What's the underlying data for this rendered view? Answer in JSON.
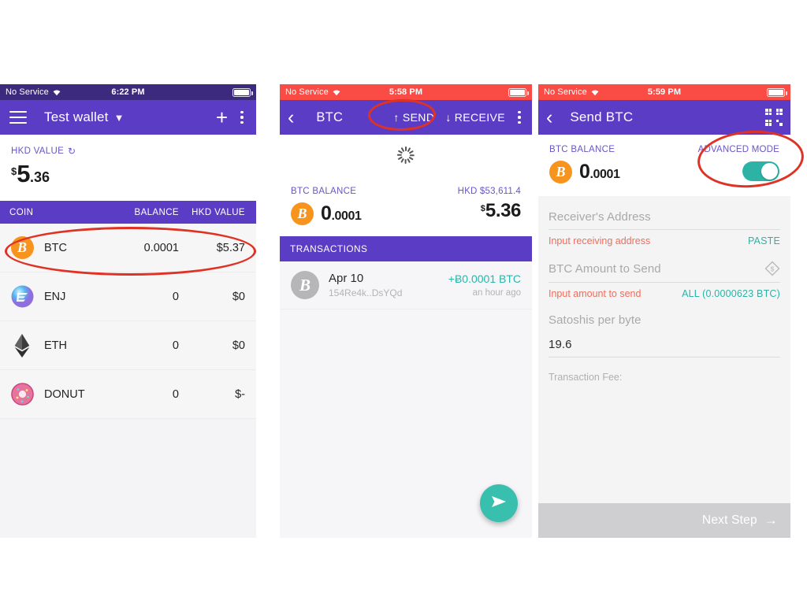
{
  "colors": {
    "purple": "#5b3cc4",
    "status_dark": "#3b2a7d",
    "status_red": "#fa4b44",
    "teal": "#2cb3a6",
    "orange": "#f7941d",
    "annotation_red": "#e03224",
    "error_red": "#ef6c5a"
  },
  "panel1": {
    "status": {
      "carrier": "No Service",
      "wifi_icon": "wifi-icon",
      "time": "6:22 PM",
      "battery_icon": "battery-full-icon"
    },
    "appbar": {
      "menu_icon": "hamburger-menu-icon",
      "title": "Test wallet",
      "caret_icon": "chevron-down-icon",
      "add_icon": "plus-icon",
      "overflow_icon": "kebab-menu-icon"
    },
    "value_card": {
      "label": "HKD VALUE",
      "refresh_icon": "refresh-icon",
      "currency_symbol": "$",
      "amount_whole": "5",
      "amount_cents": ".36"
    },
    "table": {
      "headers": {
        "coin": "COIN",
        "balance": "BALANCE",
        "value": "HKD VALUE"
      },
      "rows": [
        {
          "icon": "bitcoin-icon",
          "symbol": "₿",
          "name": "BTC",
          "balance": "0.0001",
          "value": "$5.37"
        },
        {
          "icon": "enjin-icon",
          "symbol": "E",
          "name": "ENJ",
          "balance": "0",
          "value": "$0"
        },
        {
          "icon": "ethereum-icon",
          "symbol": "◆",
          "name": "ETH",
          "balance": "0",
          "value": "$0"
        },
        {
          "icon": "donut-icon",
          "symbol": "●",
          "name": "DONUT",
          "balance": "0",
          "value": "$-"
        }
      ]
    }
  },
  "panel2": {
    "status": {
      "carrier": "No Service",
      "wifi_icon": "wifi-icon",
      "time": "5:58 PM",
      "battery_icon": "battery-full-icon"
    },
    "appbar": {
      "back_icon": "chevron-left-icon",
      "title": "BTC",
      "send_label": "SEND",
      "send_icon": "arrow-up-icon",
      "receive_label": "RECEIVE",
      "receive_icon": "arrow-down-icon",
      "overflow_icon": "kebab-menu-icon"
    },
    "loading_icon": "loading-spinner-icon",
    "balance": {
      "label": "BTC BALANCE",
      "coin_icon": "bitcoin-icon",
      "amount_whole": "0",
      "amount_decimals": ".0001",
      "rate_label": "HKD $53,611.4",
      "fiat_symbol": "$",
      "fiat_amount": "5.36"
    },
    "transactions": {
      "header": "TRANSACTIONS",
      "rows": [
        {
          "icon": "bitcoin-icon",
          "date": "Apr 10",
          "address": "154Re4k..DsYQd",
          "amount": "+Ƀ0.0001 BTC",
          "time_ago": "an hour ago"
        }
      ]
    },
    "fab": {
      "icon": "send-plane-icon",
      "label": "Send"
    }
  },
  "panel3": {
    "status": {
      "carrier": "No Service",
      "wifi_icon": "wifi-icon",
      "time": "5:59 PM",
      "battery_icon": "battery-full-icon"
    },
    "appbar": {
      "back_icon": "chevron-left-icon",
      "title": "Send BTC",
      "scan_icon": "qr-code-scanner-icon"
    },
    "balance": {
      "label": "BTC BALANCE",
      "coin_icon": "bitcoin-icon",
      "amount_whole": "0",
      "amount_decimals": ".0001"
    },
    "advanced_mode": {
      "label": "ADVANCED MODE",
      "toggle_state": "on"
    },
    "form": {
      "address": {
        "placeholder": "Receiver's Address",
        "value": "",
        "error": "Input receiving address",
        "action": "PASTE"
      },
      "amount": {
        "placeholder": "BTC Amount to Send",
        "value": "",
        "error": "Input amount to send",
        "action": "ALL (0.0000623 BTC)",
        "currency_toggle_icon": "currency-switch-icon"
      },
      "fee_rate": {
        "label": "Satoshis per byte",
        "value": "19.6"
      },
      "transaction_fee_label": "Transaction Fee:"
    },
    "next_button": {
      "label": "Next Step",
      "icon": "arrow-right-icon",
      "enabled": "false"
    }
  },
  "annotations": [
    {
      "name": "highlight-btc-row",
      "target": "panel1 BTC row"
    },
    {
      "name": "highlight-send-button",
      "target": "panel2 SEND action"
    },
    {
      "name": "highlight-advanced-mode",
      "target": "panel3 ADVANCED MODE toggle"
    }
  ]
}
